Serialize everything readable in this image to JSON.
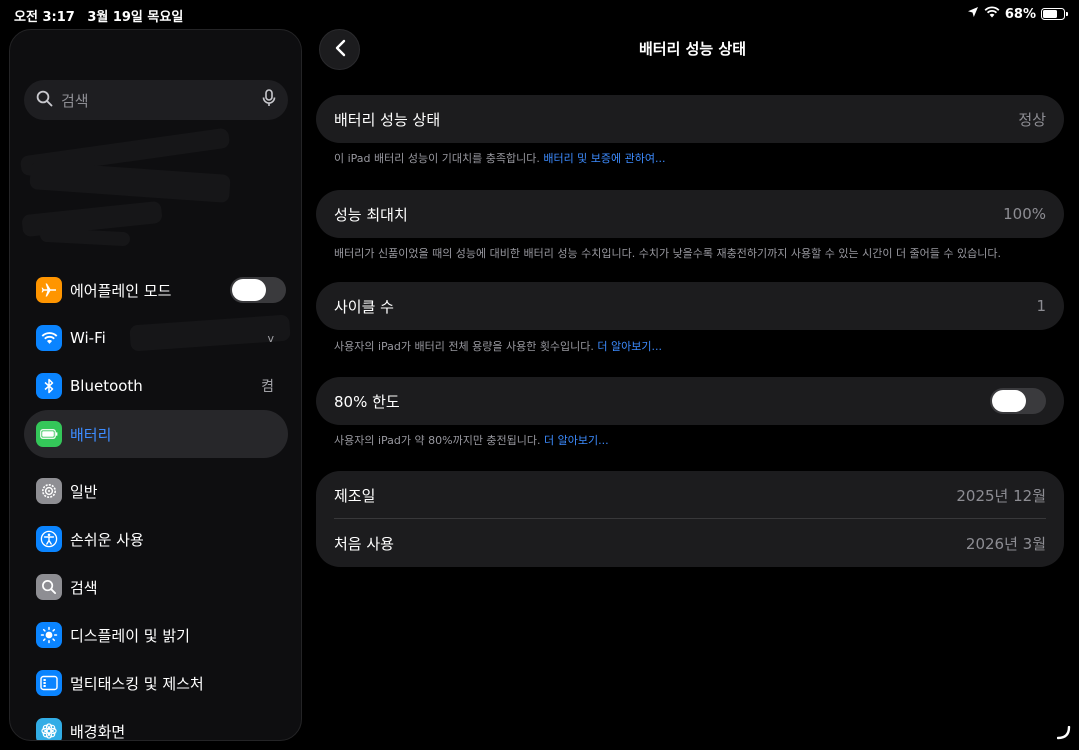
{
  "status": {
    "time": "오전 3:17",
    "date": "3월 19일 목요일",
    "battery_percent": "68%",
    "battery_level": 0.68
  },
  "sidebar": {
    "search_placeholder": "검색",
    "items": [
      {
        "label": "에어플레인 모드",
        "icon": "airplane-icon",
        "color": "#ff9500",
        "toggle": false
      },
      {
        "label": "Wi-Fi",
        "icon": "wifi-icon",
        "color": "#0a84ff",
        "value": "v"
      },
      {
        "label": "Bluetooth",
        "icon": "bluetooth-icon",
        "color": "#0a84ff",
        "value": "켬"
      },
      {
        "label": "배터리",
        "icon": "battery-icon",
        "color": "#34c759",
        "active": true
      },
      {
        "label": "일반",
        "icon": "gear-icon",
        "color": "#8e8e93"
      },
      {
        "label": "손쉬운 사용",
        "icon": "accessibility-icon",
        "color": "#0a84ff"
      },
      {
        "label": "검색",
        "icon": "search-icon",
        "color": "#8e8e93"
      },
      {
        "label": "디스플레이 및 밝기",
        "icon": "sun-icon",
        "color": "#0a84ff"
      },
      {
        "label": "멀티태스킹 및 제스처",
        "icon": "multitasking-icon",
        "color": "#0a84ff"
      },
      {
        "label": "배경화면",
        "icon": "flower-icon",
        "color": "#32ade6"
      }
    ]
  },
  "page": {
    "title": "배터리 성능 상태"
  },
  "sections": {
    "health": {
      "label": "배터리 성능 상태",
      "value": "정상",
      "footer_text": "이 iPad 배터리 성능이 기대치를 충족합니다.",
      "footer_link": "배터리 및 보증에 관하여..."
    },
    "max_capacity": {
      "label": "성능 최대치",
      "value": "100%",
      "footer_text": "배터리가 신품이었을 때의 성능에 대비한 배터리 성능 수치입니다. 수치가 낮을수록 재충전하기까지 사용할 수 있는 시간이 더 줄어들 수 있습니다."
    },
    "cycle_count": {
      "label": "사이클 수",
      "value": "1",
      "footer_text": "사용자의 iPad가 배터리 전체 용량을 사용한 횟수입니다.",
      "footer_link": "더 알아보기..."
    },
    "limit_80": {
      "label": "80% 한도",
      "toggle": false,
      "footer_text": "사용자의 iPad가 약 80%까지만 충전됩니다.",
      "footer_link": "더 알아보기..."
    },
    "dates": {
      "manufacture_label": "제조일",
      "manufacture_value": "2025년 12월",
      "first_use_label": "처음 사용",
      "first_use_value": "2026년 3월"
    }
  }
}
